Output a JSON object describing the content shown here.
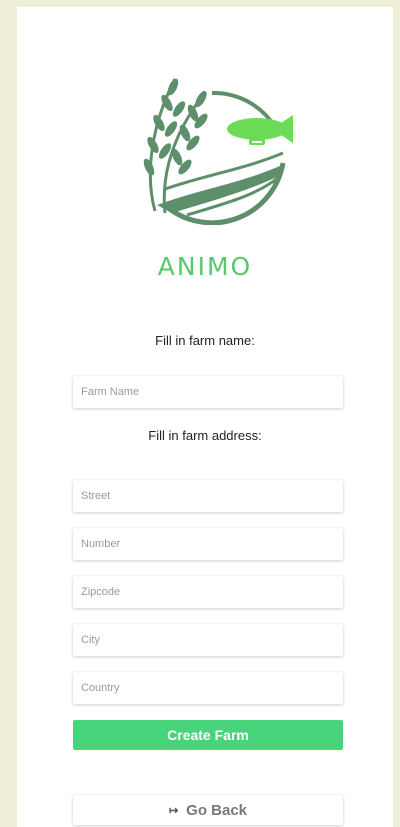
{
  "brand": {
    "name": "ANIMO"
  },
  "form": {
    "farm_name_label": "Fill in farm name:",
    "farm_name_placeholder": "Farm Name",
    "address_label": "Fill in farm address:",
    "street_placeholder": "Street",
    "number_placeholder": "Number",
    "zipcode_placeholder": "Zipcode",
    "city_placeholder": "City",
    "country_placeholder": "Country",
    "create_label": "Create Farm",
    "back_label": "Go Back"
  },
  "icons": {
    "logo": "wheat-blimp-logo-icon",
    "back": "sign-out-arrow-icon"
  },
  "colors": {
    "background": "#efeed6",
    "brand_green": "#57c86c",
    "button_green": "#48d47a",
    "logo_dark_green": "#5e8f6b"
  }
}
